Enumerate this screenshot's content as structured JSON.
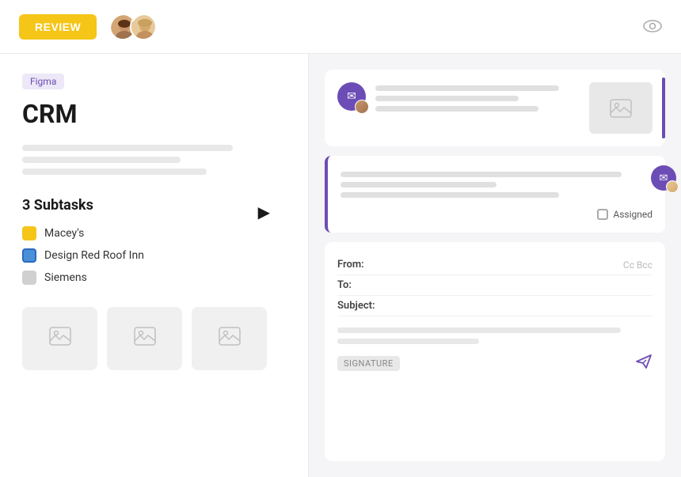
{
  "topbar": {
    "review_label": "REVIEW",
    "eye_icon": "👁"
  },
  "left": {
    "tag_label": "Figma",
    "title": "CRM",
    "subtasks_heading": "3 Subtasks",
    "subtasks": [
      {
        "id": 1,
        "label": "Macey's",
        "icon_type": "yellow"
      },
      {
        "id": 2,
        "label": "Design Red Roof Inn",
        "icon_type": "blue"
      },
      {
        "id": 3,
        "label": "Siemens",
        "icon_type": "gray"
      }
    ]
  },
  "right": {
    "assigned_label": "Assigned",
    "email_compose": {
      "from_label": "From:",
      "to_label": "To:",
      "subject_label": "Subject:",
      "cc_bcc_label": "Cc Bcc",
      "signature_label": "SIGNATURE"
    }
  }
}
